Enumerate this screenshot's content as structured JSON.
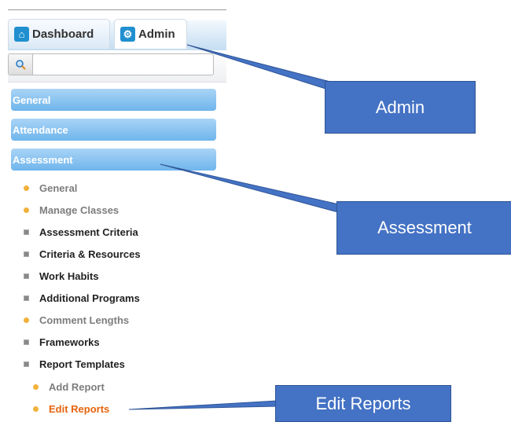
{
  "tabs": {
    "dashboard": "Dashboard",
    "admin": "Admin"
  },
  "search": {
    "value": "",
    "placeholder": ""
  },
  "sections": [
    "General",
    "Attendance",
    "Assessment"
  ],
  "assessment_items": [
    {
      "label": "General",
      "marker": "dot",
      "style": "gray"
    },
    {
      "label": "Manage Classes",
      "marker": "dot",
      "style": "gray"
    },
    {
      "label": "Assessment Criteria",
      "marker": "square",
      "style": "dark"
    },
    {
      "label": "Criteria & Resources",
      "marker": "square",
      "style": "dark"
    },
    {
      "label": "Work Habits",
      "marker": "square",
      "style": "dark"
    },
    {
      "label": "Additional Programs",
      "marker": "square",
      "style": "dark"
    },
    {
      "label": "Comment Lengths",
      "marker": "dot",
      "style": "gray"
    },
    {
      "label": "Frameworks",
      "marker": "square",
      "style": "dark"
    },
    {
      "label": "Report Templates",
      "marker": "square",
      "style": "dark"
    }
  ],
  "report_template_items": [
    {
      "label": "Add Report",
      "marker": "dot",
      "style": "gray"
    },
    {
      "label": "Edit Reports",
      "marker": "dot",
      "style": "active"
    }
  ],
  "callouts": {
    "admin": "Admin",
    "assessment": "Assessment",
    "edit_reports": "Edit Reports"
  },
  "colors": {
    "section_button": "#6fb5ec",
    "active_item": "#e5640c",
    "callout_fill": "#4472c4",
    "bullet": "#f1b13b"
  }
}
